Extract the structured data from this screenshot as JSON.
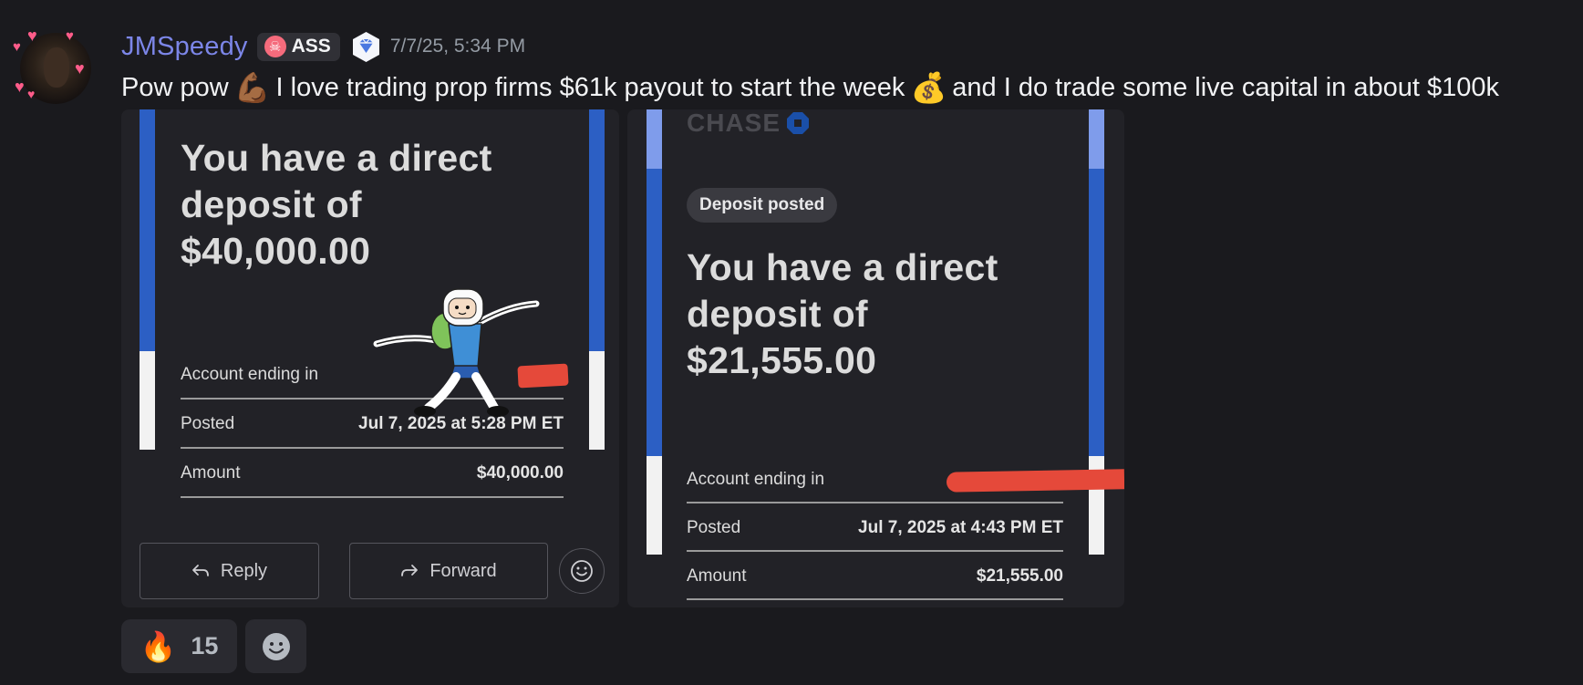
{
  "message": {
    "username": "JMSpeedy",
    "role_tag": "ASS",
    "timestamp": "7/7/25, 5:34 PM",
    "text_part1": "Pow pow",
    "emoji1": "💪🏾",
    "text_part2": "I love trading prop firms $61k payout to start the week",
    "emoji2": "💰",
    "text_part3": "and I do trade some live capital in about $100k"
  },
  "attachments": [
    {
      "heading_line1": "You have a direct",
      "heading_line2": "deposit of",
      "heading_line3": "$40,000.00",
      "account_label": "Account ending in",
      "posted_label": "Posted",
      "posted_value": "Jul 7, 2025 at 5:28 PM ET",
      "amount_label": "Amount",
      "amount_value": "$40,000.00",
      "reply_label": "Reply",
      "forward_label": "Forward"
    },
    {
      "logo_text": "CHASE",
      "tag": "Deposit posted",
      "heading_line1": "You have a direct",
      "heading_line2": "deposit of",
      "heading_line3": "$21,555.00",
      "account_label": "Account ending in",
      "posted_label": "Posted",
      "posted_value": "Jul 7, 2025 at 4:43 PM ET",
      "amount_label": "Amount",
      "amount_value": "$21,555.00"
    }
  ],
  "reactions": [
    {
      "emoji": "🔥",
      "count": "15"
    }
  ],
  "colors": {
    "background": "#1a1a1e",
    "username": "#7c86e8",
    "stripe_blue": "#2c5fc4",
    "redaction": "#e5493a"
  }
}
